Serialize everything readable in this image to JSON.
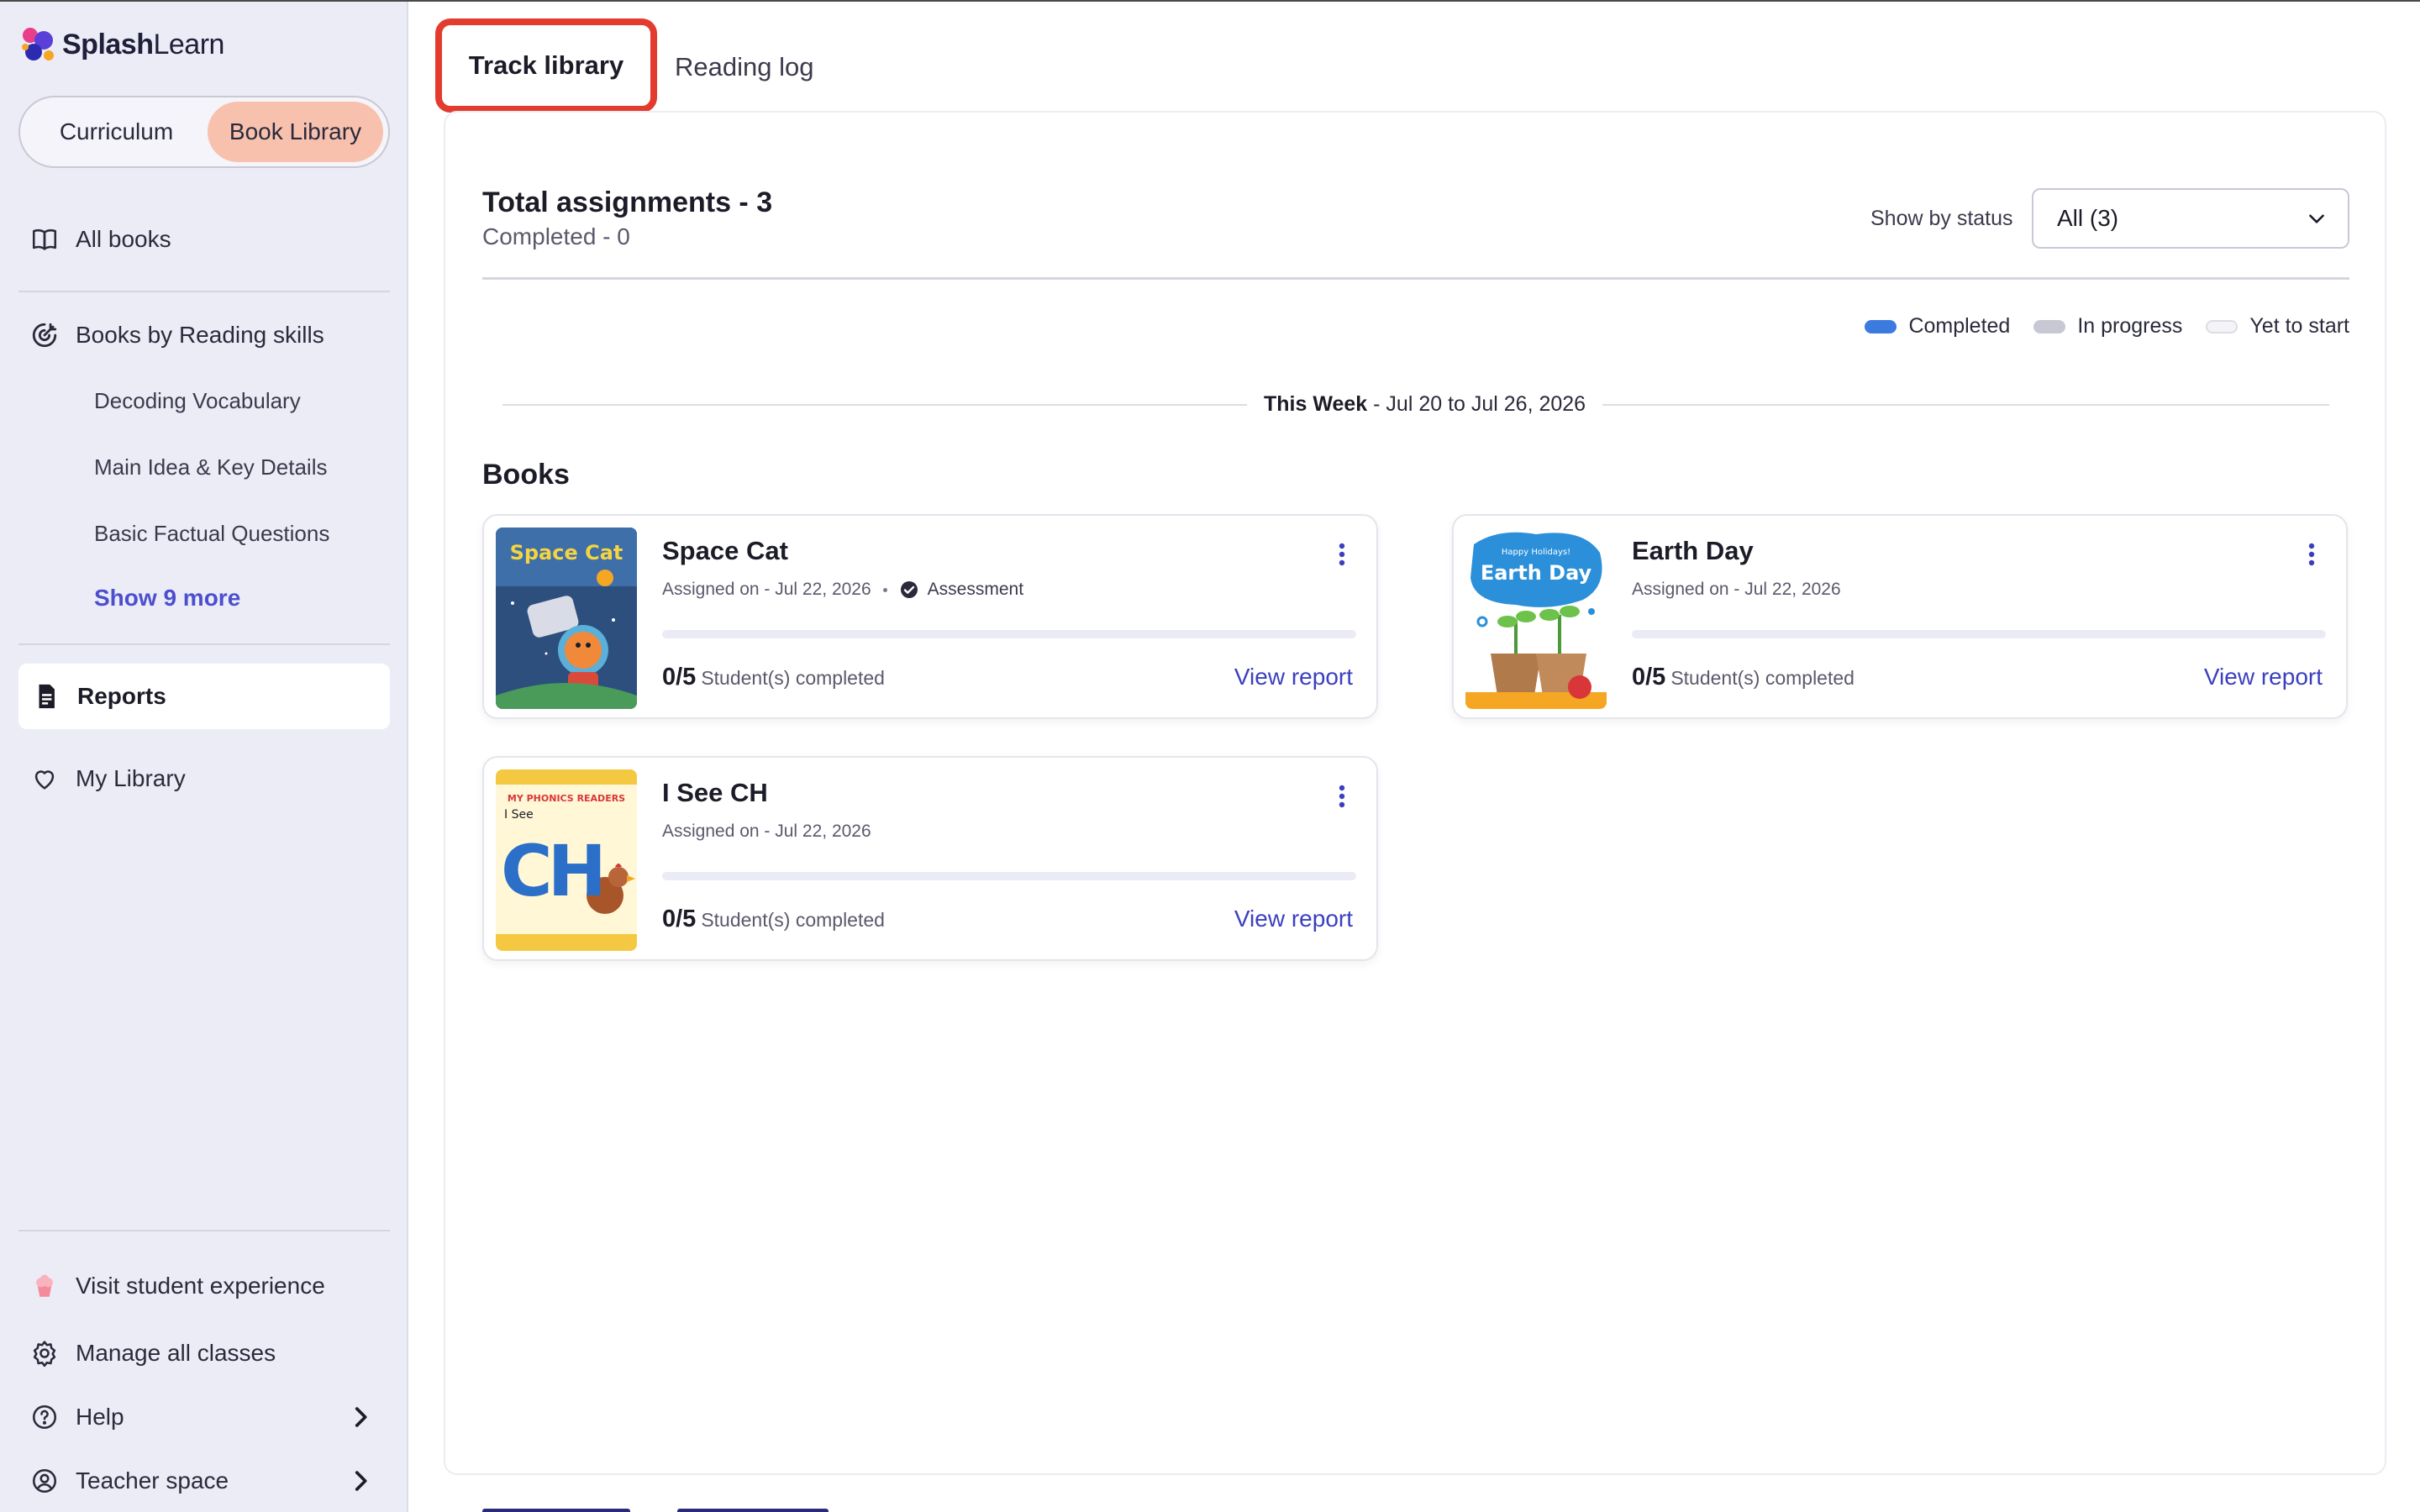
{
  "brand": {
    "name_bold": "Splash",
    "name_regular": "Learn"
  },
  "sidebar": {
    "toggle": {
      "curriculum": "Curriculum",
      "book_library": "Book Library"
    },
    "all_books": "All books",
    "reading_skills": {
      "label": "Books by Reading skills",
      "items": [
        "Decoding Vocabulary",
        "Main Idea & Key Details",
        "Basic Factual Questions"
      ],
      "show_more": "Show 9 more"
    },
    "reports": "Reports",
    "my_library": "My Library",
    "footer": {
      "visit_student": "Visit student experience",
      "manage_classes": "Manage all classes",
      "help": "Help",
      "teacher_space": "Teacher space"
    }
  },
  "tabs": {
    "track_library": "Track library",
    "reading_log": "Reading log"
  },
  "summary": {
    "total": "Total assignments - 3",
    "completed": "Completed - 0",
    "status_label": "Show by status",
    "status_value": "All (3)"
  },
  "legend": {
    "completed": "Completed",
    "in_progress": "In progress",
    "yet_to_start": "Yet to start",
    "colors": {
      "completed": "#3b7be0",
      "in_progress": "#c8c8d4",
      "yet_to_start": "#f4f4f8"
    }
  },
  "week": {
    "label": "This Week",
    "range": " - Jul 20 to Jul 26, 2026"
  },
  "books_heading": "Books",
  "books": [
    {
      "title": "Space Cat",
      "assigned": "Assigned on - Jul 22, 2026",
      "tag": "Assessment",
      "count": "0/5",
      "count_label": "Student(s) completed",
      "progress": 0,
      "action": "View report",
      "cover_text": "Space Cat"
    },
    {
      "title": "Earth Day",
      "assigned": "Assigned on - Jul 22, 2026",
      "count": "0/5",
      "count_label": "Student(s) completed",
      "progress": 0,
      "action": "View report",
      "cover_text": "Earth Day",
      "cover_subtext": "Happy Holidays!"
    },
    {
      "title": "I See CH",
      "assigned": "Assigned on - Jul 22, 2026",
      "count": "0/5",
      "count_label": "Student(s) completed",
      "progress": 0,
      "action": "View report",
      "cover_text": "CH",
      "cover_subtext": "I See",
      "cover_series": "MY PHONICS READERS"
    }
  ]
}
